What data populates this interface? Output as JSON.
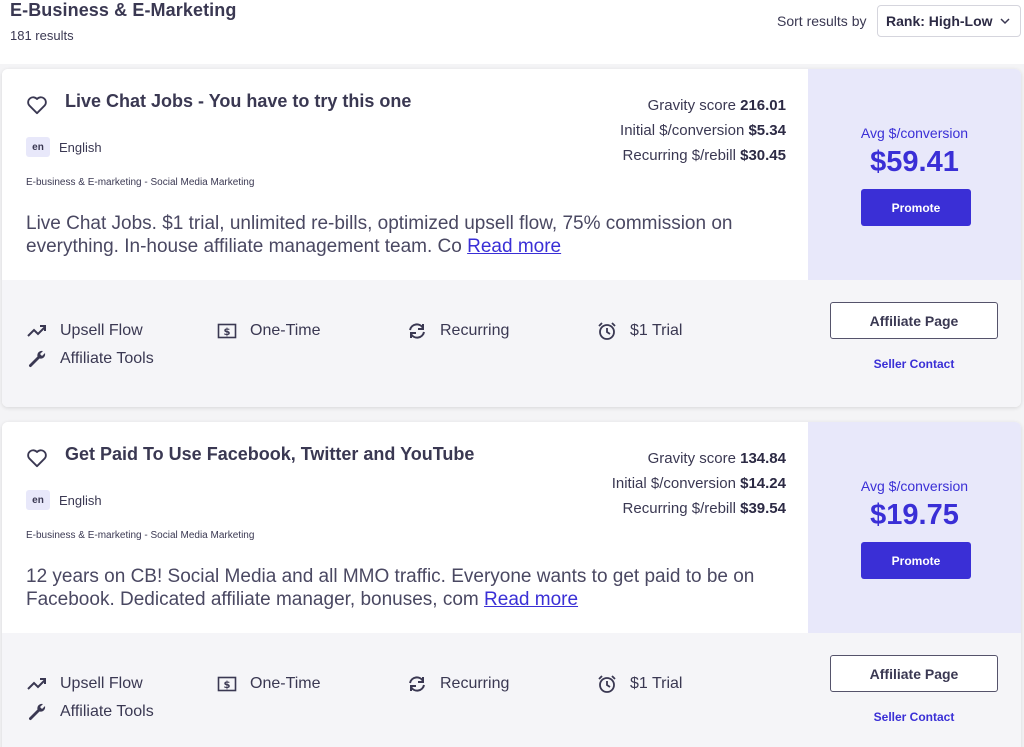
{
  "header": {
    "title": "E-Business & E-Marketing",
    "results_count": "181 results",
    "sort_label": "Sort results by",
    "sort_value": "Rank: High-Low"
  },
  "products": [
    {
      "title": "Live Chat Jobs - You have to try this one",
      "lang_code": "en",
      "lang_name": "English",
      "category": "E-business & E-marketing - Social Media Marketing",
      "description": "Live Chat Jobs. $1 trial, unlimited re-bills, optimized upsell flow, 75% commission on everything. In-house affiliate management team. Co",
      "read_more": "Read more",
      "gravity_label": "Gravity score",
      "gravity_value": "216.01",
      "initial_label": "Initial $/conversion",
      "initial_value": "$5.34",
      "recurring_label": "Recurring $/rebill",
      "recurring_value": "$30.45",
      "avg_label": "Avg $/conversion",
      "avg_value": "$59.41",
      "promote_label": "Promote",
      "features": [
        "Upsell Flow",
        "One-Time",
        "Recurring",
        "$1 Trial",
        "Affiliate Tools"
      ],
      "affiliate_page_label": "Affiliate Page",
      "seller_contact_label": "Seller Contact"
    },
    {
      "title": "Get Paid To Use Facebook, Twitter and YouTube",
      "lang_code": "en",
      "lang_name": "English",
      "category": "E-business & E-marketing - Social Media Marketing",
      "description": "12 years on CB! Social Media and all MMO traffic. Everyone wants to get paid to be on Facebook. Dedicated affiliate manager, bonuses, com",
      "read_more": "Read more",
      "gravity_label": "Gravity score",
      "gravity_value": "134.84",
      "initial_label": "Initial $/conversion",
      "initial_value": "$14.24",
      "recurring_label": "Recurring $/rebill",
      "recurring_value": "$39.54",
      "avg_label": "Avg $/conversion",
      "avg_value": "$19.75",
      "promote_label": "Promote",
      "features": [
        "Upsell Flow",
        "One-Time",
        "Recurring",
        "$1 Trial",
        "Affiliate Tools"
      ],
      "affiliate_page_label": "Affiliate Page",
      "seller_contact_label": "Seller Contact"
    }
  ],
  "icons": {
    "favorite": "heart-icon",
    "upsell": "trend-up-icon",
    "one_time": "dollar-bill-icon",
    "recurring": "refresh-icon",
    "trial": "alarm-clock-icon",
    "tools": "wrench-icon",
    "sort": "chevron-down-icon"
  },
  "colors": {
    "accent": "#3a2fd6",
    "panel": "#e8e8fa",
    "text": "#3a3852"
  }
}
